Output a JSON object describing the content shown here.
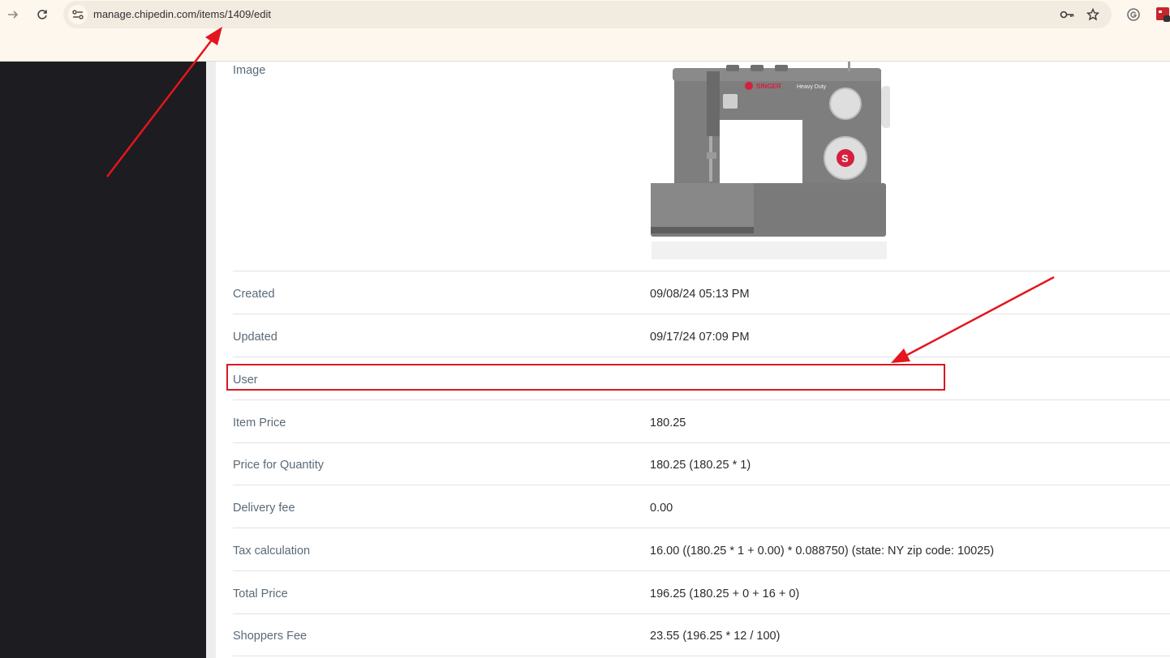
{
  "browser": {
    "url": "manage.chipedin.com/items/1409/edit",
    "icons": {
      "forward": "forward-arrow-icon",
      "reload": "reload-icon",
      "site_info": "tune-icon",
      "password": "key-icon",
      "bookmark": "star-icon",
      "extension_1": "grammarly-g-icon",
      "extension_2": "red-extension-icon"
    }
  },
  "item": {
    "image_label": "Image",
    "image_brand_text": "SINGER",
    "image_model_text": "Heavy Duty",
    "rows": [
      {
        "label": "Created",
        "value": "09/08/24 05:13 PM"
      },
      {
        "label": "Updated",
        "value": "09/17/24 07:09 PM"
      },
      {
        "label": "User",
        "value": ""
      },
      {
        "label": "Item Price",
        "value": "180.25"
      },
      {
        "label": "Price for Quantity",
        "value": "180.25 (180.25 * 1)"
      },
      {
        "label": "Delivery fee",
        "value": "0.00"
      },
      {
        "label": "Tax calculation",
        "value": "16.00 ((180.25 * 1 + 0.00) * 0.088750) (state: NY zip code: 10025)"
      },
      {
        "label": "Total Price",
        "value": "196.25 (180.25 + 0 + 16 + 0)"
      },
      {
        "label": "Shoppers Fee",
        "value": "23.55 (196.25 * 12 / 100)"
      }
    ]
  },
  "colors": {
    "sidebar": "#1d1c21",
    "annotation": "#d71921",
    "label_text": "#5a6a78",
    "browser_chrome": "#fdf7ee"
  }
}
